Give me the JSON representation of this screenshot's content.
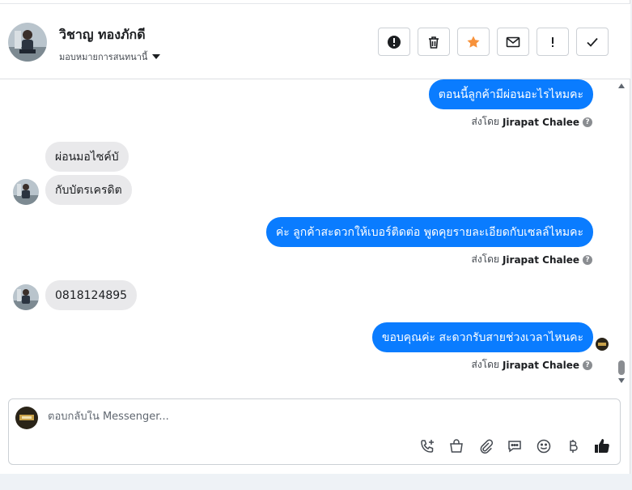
{
  "header": {
    "contact_name": "วิชาญ ทองภักดี",
    "assign_label": "มอบหมายการสนทนานี้",
    "actions": [
      {
        "name": "spam-button",
        "icon": "alert-circle-icon"
      },
      {
        "name": "delete-button",
        "icon": "trash-icon"
      },
      {
        "name": "star-button",
        "icon": "star-icon",
        "color": "#f7923b"
      },
      {
        "name": "mark-unread-button",
        "icon": "envelope-icon"
      },
      {
        "name": "follow-up-button",
        "icon": "exclamation-icon"
      },
      {
        "name": "mark-done-button",
        "icon": "checkmark-icon"
      }
    ]
  },
  "messages": [
    {
      "direction": "out",
      "text": "ตอนนี้ลูกค้ามีผ่อนอะไรไหมคะ",
      "sent_by_prefix": "ส่งโดย",
      "sent_by_name": "Jirapat Chalee"
    },
    {
      "direction": "in",
      "text": "ผ่อนมอไซค์บั"
    },
    {
      "direction": "in",
      "text": "กับบัตรเครดิต"
    },
    {
      "direction": "out",
      "text": "ค่ะ ลูกค้าสะดวกให้เบอร์ติดต่อ พูดคุยรายละเอียดกับเซลล์ไหมคะ",
      "sent_by_prefix": "ส่งโดย",
      "sent_by_name": "Jirapat Chalee"
    },
    {
      "direction": "in",
      "text": "0818124895"
    },
    {
      "direction": "out",
      "text": "ขอบคุณค่ะ สะดวกรับสายช่วงเวลาไหนคะ",
      "sent_by_prefix": "ส่งโดย",
      "sent_by_name": "Jirapat Chalee"
    }
  ],
  "composer": {
    "placeholder": "ตอบกลับใน Messenger...",
    "value": "",
    "icons": [
      "phone-add-icon",
      "shopping-bag-icon",
      "paperclip-icon",
      "chat-bubble-icon",
      "emoji-icon",
      "baht-icon",
      "thumbs-up-icon"
    ]
  },
  "colors": {
    "outgoing_bubble": "#0a7cff",
    "incoming_bubble": "#e9e9eb",
    "star": "#f7923b"
  }
}
